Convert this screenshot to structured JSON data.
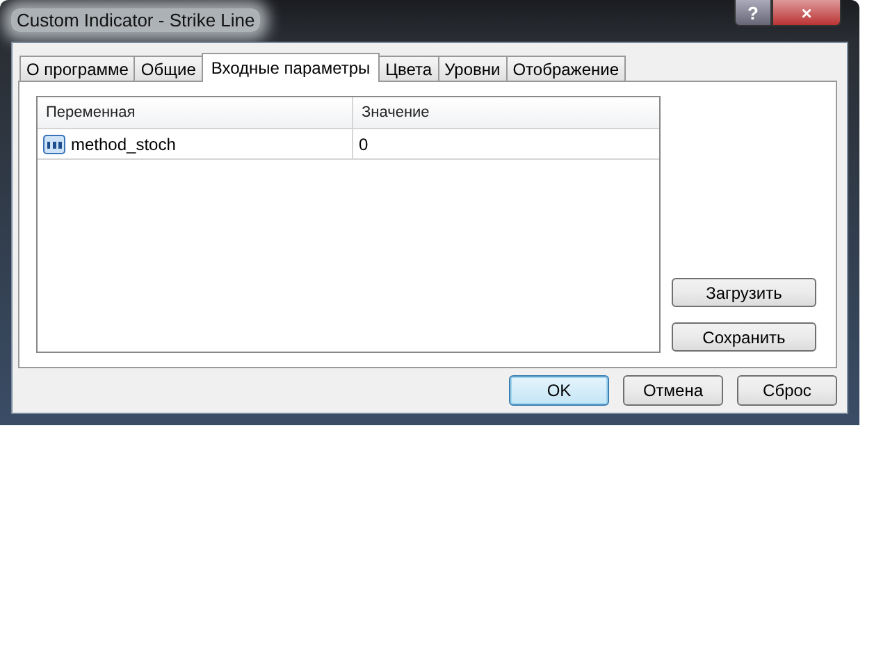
{
  "window": {
    "title": "Custom Indicator - Strike Line",
    "title_buttons": [
      "?",
      "×"
    ]
  },
  "tabs": [
    {
      "label": "О программе",
      "selected": false
    },
    {
      "label": "Общие",
      "selected": false
    },
    {
      "label": "Входные параметры",
      "selected": true
    },
    {
      "label": "Цвета",
      "selected": false
    },
    {
      "label": "Уровни",
      "selected": false
    },
    {
      "label": "Отображение",
      "selected": false
    }
  ],
  "table": {
    "columns": [
      "Переменная",
      "Значение"
    ],
    "rows": [
      {
        "name": "method_stoch",
        "value": "0"
      }
    ]
  },
  "side_buttons": [
    "Загрузить",
    "Сохранить"
  ],
  "buttons": [
    {
      "label": "OK",
      "default": true
    },
    {
      "label": "Отмена",
      "default": false
    },
    {
      "label": "Сброс",
      "default": false
    }
  ]
}
